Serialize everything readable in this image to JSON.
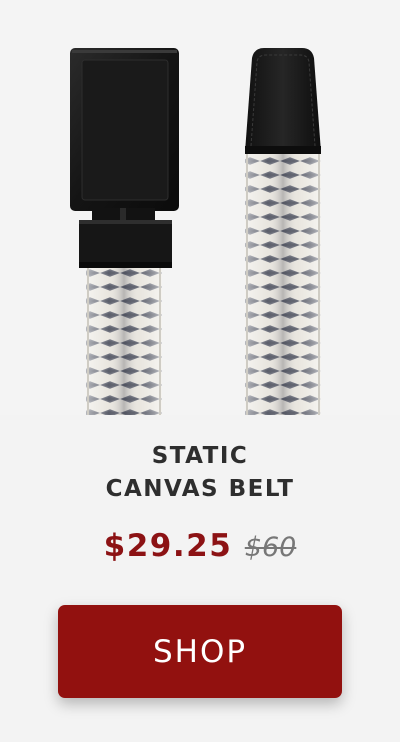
{
  "product": {
    "title_line1": "STATIC",
    "title_line2": "CANVAS BELT",
    "sale_price": "$29.25",
    "original_price": "$60",
    "image_icon": "belt-product-photo"
  },
  "cta": {
    "label": "SHOP"
  },
  "colors": {
    "accent": "#92110f",
    "sale_price": "#8c1214",
    "buckle": "#161616",
    "strap_stripe": "#6b6d78",
    "strap_base": "#e8e5de"
  }
}
